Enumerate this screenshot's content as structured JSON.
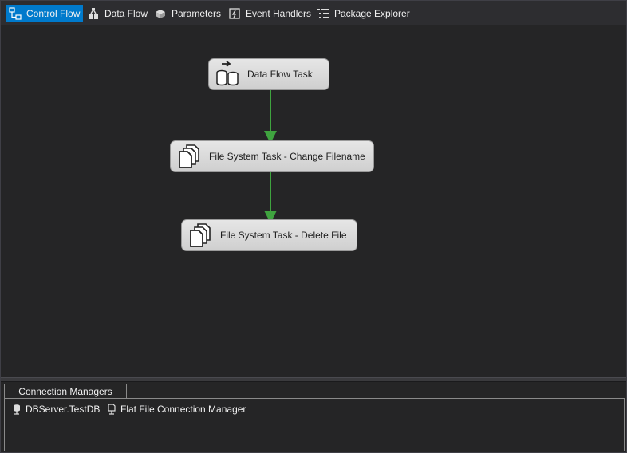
{
  "tabs": [
    {
      "label": "Control Flow",
      "icon": "control-flow-icon",
      "active": true
    },
    {
      "label": "Data Flow",
      "icon": "data-flow-icon",
      "active": false
    },
    {
      "label": "Parameters",
      "icon": "parameters-icon",
      "active": false
    },
    {
      "label": "Event Handlers",
      "icon": "event-handlers-icon",
      "active": false
    },
    {
      "label": "Package Explorer",
      "icon": "package-explorer-icon",
      "active": false
    }
  ],
  "tasks": [
    {
      "label": "Data Flow Task",
      "icon": "data-flow-task-icon"
    },
    {
      "label": "File System Task - Change Filename",
      "icon": "file-system-task-icon"
    },
    {
      "label": "File System Task - Delete File",
      "icon": "file-system-task-icon"
    }
  ],
  "connection_managers": {
    "tab_label": "Connection Managers",
    "items": [
      {
        "label": "DBServer.TestDB",
        "icon": "database-connection-icon"
      },
      {
        "label": "Flat File Connection Manager",
        "icon": "flat-file-connection-icon"
      }
    ]
  },
  "colors": {
    "background": "#252526",
    "active_tab": "#007acc",
    "precedence_arrow": "#3fa33f",
    "task_fill": "#dcdcdc"
  }
}
